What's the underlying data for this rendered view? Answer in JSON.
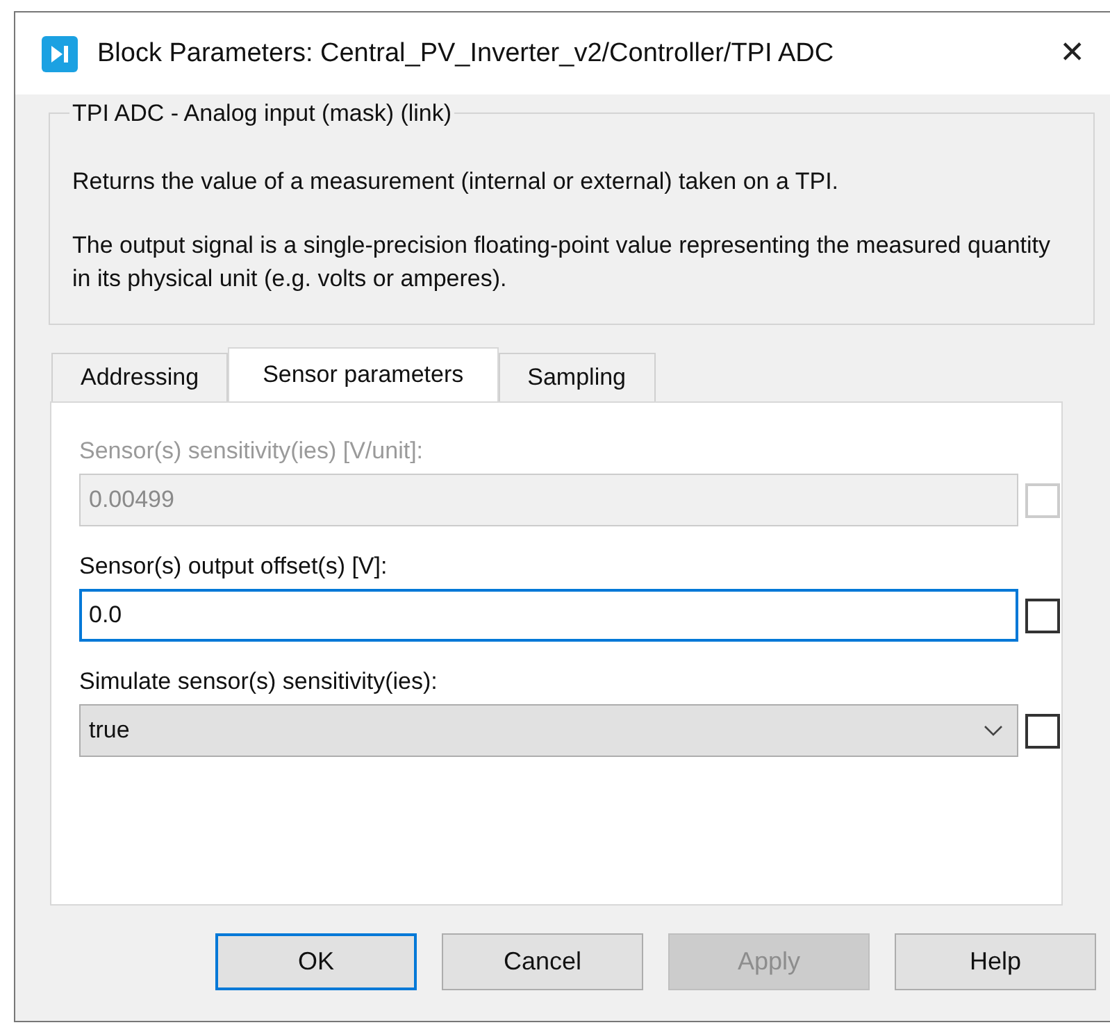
{
  "window": {
    "title": "Block Parameters: Central_PV_Inverter_v2/Controller/TPI ADC",
    "close": "✕"
  },
  "description": {
    "title": "TPI ADC - Analog input (mask) (link)",
    "paragraphs": [
      "Returns the value of a measurement (internal or external) taken on a TPI.",
      "The output signal is a single-precision floating-point value representing the measured quantity in its physical unit (e.g. volts or amperes)."
    ]
  },
  "tabs": [
    {
      "label": "Addressing",
      "selected": false
    },
    {
      "label": "Sensor parameters",
      "selected": true
    },
    {
      "label": "Sampling",
      "selected": false
    }
  ],
  "parameters": [
    {
      "kind": "edit",
      "label": "Sensor(s) sensitivity(ies) [V/unit]:",
      "value": "0.00499",
      "disabled": true,
      "focused": false,
      "checked": false
    },
    {
      "kind": "edit",
      "label": "Sensor(s) output offset(s) [V]:",
      "value": "0.0",
      "disabled": false,
      "focused": true,
      "checked": false
    },
    {
      "kind": "popup",
      "label": "Simulate sensor(s) sensitivity(ies):",
      "value": "true",
      "disabled": false,
      "focused": false,
      "checked": false
    }
  ],
  "buttons": [
    {
      "label": "OK",
      "default": true,
      "disabled": false
    },
    {
      "label": "Cancel",
      "default": false,
      "disabled": false
    },
    {
      "label": "Apply",
      "default": false,
      "disabled": true
    },
    {
      "label": "Help",
      "default": false,
      "disabled": false
    }
  ]
}
